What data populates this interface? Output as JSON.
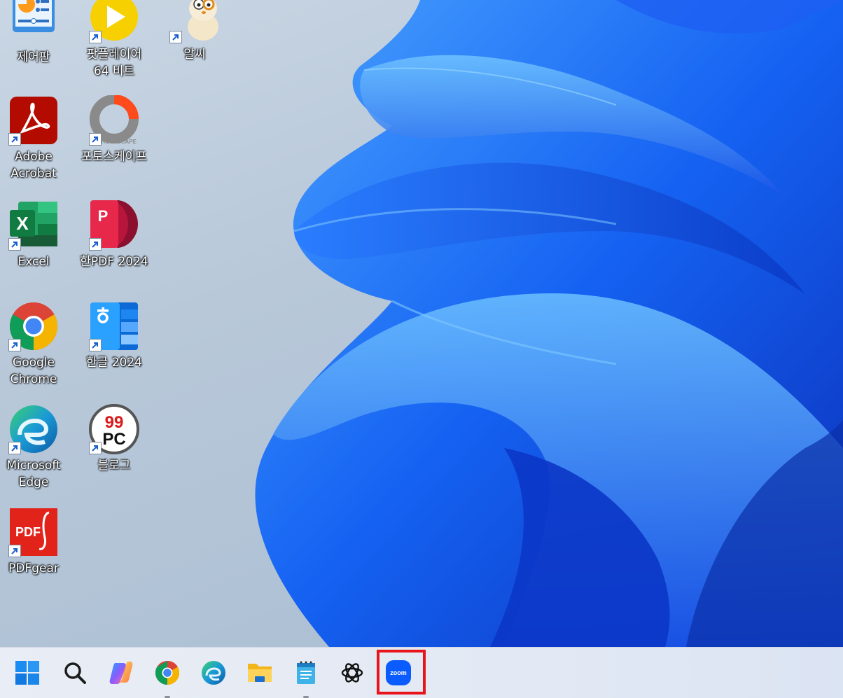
{
  "desktop": {
    "icons": [
      {
        "label": "제어판",
        "icon": "control-panel-icon"
      },
      {
        "label": "팟플레이어\n64 비트",
        "icon": "potplayer-icon"
      },
      {
        "label": "알씨",
        "icon": "alsee-icon"
      },
      {
        "label": "Adobe\nAcrobat",
        "icon": "adobe-acrobat-icon"
      },
      {
        "label": "포토스케이프",
        "icon": "photoscape-icon"
      },
      {
        "label": "Excel",
        "icon": "excel-icon"
      },
      {
        "label": "한PDF 2024",
        "icon": "hanpdf-icon"
      },
      {
        "label": "Google\nChrome",
        "icon": "chrome-icon"
      },
      {
        "label": "한글 2024",
        "icon": "hangul-icon"
      },
      {
        "label": "Microsoft\nEdge",
        "icon": "edge-icon"
      },
      {
        "label": "블로그",
        "icon": "blog-99pc-icon"
      },
      {
        "label": "PDFgear",
        "icon": "pdfgear-icon"
      }
    ],
    "pdf_badge": "PDF",
    "blog_badge_top": "99",
    "blog_badge_bottom": "PC",
    "photoscape_badge": "PHOTOSCAPE",
    "excel_letter": "X",
    "hanpdf_letter": "P"
  },
  "taskbar": {
    "items": [
      {
        "name": "start-button",
        "icon": "windows-logo-icon"
      },
      {
        "name": "search-button",
        "icon": "search-icon"
      },
      {
        "name": "copilot-button",
        "icon": "copilot-icon"
      },
      {
        "name": "chrome-taskbar-button",
        "icon": "chrome-icon",
        "running": true
      },
      {
        "name": "edge-taskbar-button",
        "icon": "edge-icon"
      },
      {
        "name": "file-explorer-button",
        "icon": "folder-icon"
      },
      {
        "name": "notepad-button",
        "icon": "notepad-icon",
        "running": true
      },
      {
        "name": "chatgpt-button",
        "icon": "chatgpt-icon"
      },
      {
        "name": "zoom-button",
        "icon": "zoom-icon",
        "highlighted": true
      }
    ],
    "zoom_text": "zoom"
  },
  "colors": {
    "highlight": "#e8141b",
    "accent": "#1a6dff"
  }
}
